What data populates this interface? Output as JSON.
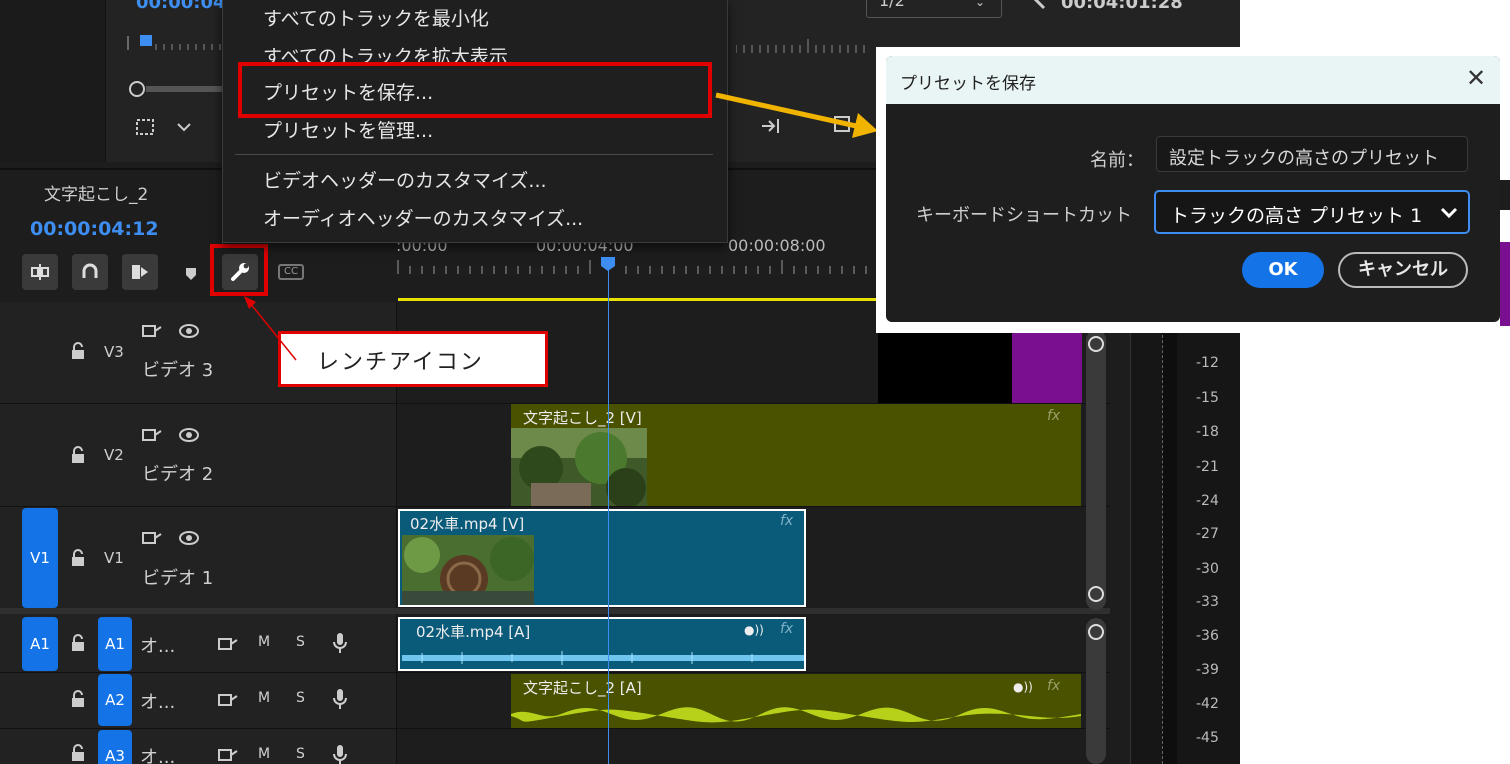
{
  "menu": {
    "items": [
      "すべてのトラックを最小化",
      "すべてのトラックを拡大表示",
      "プリセットを保存...",
      "プリセットを管理...",
      "ビデオヘッダーのカスタマイズ...",
      "オーディオヘッダーのカスタマイズ..."
    ]
  },
  "monitor": {
    "timecode_left": "00:00:04",
    "page_select": "1/2",
    "timecode_right": "00:04:01:28"
  },
  "sequence": {
    "name": "文字起こし_2",
    "timecode": "00:00:04:12"
  },
  "ruler": {
    "labels": [
      ":00:00",
      "00:00:04:00",
      "00:00:08:00"
    ]
  },
  "tracks": {
    "v3": {
      "id": "V3",
      "name": "ビデオ 3"
    },
    "v2": {
      "id": "V2",
      "name": "ビデオ 2"
    },
    "v1": {
      "src": "V1",
      "id": "V1",
      "name": "ビデオ 1"
    },
    "a1": {
      "src": "A1",
      "id": "A1",
      "name": "オ...",
      "m": "M",
      "s": "S"
    },
    "a2": {
      "id": "A2",
      "name": "オ...",
      "m": "M",
      "s": "S"
    },
    "a3": {
      "id": "A3",
      "name": "オ...",
      "m": "M",
      "s": "S"
    }
  },
  "clips": {
    "v2": "文字起こし_2 [V]",
    "v1": "02水車.mp4 [V]",
    "a1": "02水車.mp4 [A]",
    "a2": "文字起こし_2 [A]",
    "fx": "fx"
  },
  "meter": {
    "labels": [
      "-12",
      "-15",
      "-18",
      "-21",
      "-24",
      "-27",
      "-30",
      "-33",
      "-36",
      "-39",
      "-42",
      "-45"
    ]
  },
  "callout": {
    "label": "レンチアイコン"
  },
  "dialog": {
    "title": "プリセットを保存",
    "name_label": "名前：",
    "name_value": "設定トラックの高さのプリセット",
    "shortcut_label": "キーボードショートカット",
    "shortcut_value": "トラックの高さ プリセット 1",
    "ok": "OK",
    "cancel": "キャンセル"
  },
  "colors": {
    "accent_blue": "#1473e6",
    "highlight_red": "#e00000",
    "arrow_yellow": "#f0b400",
    "clip_olive": "#4a5200",
    "clip_teal": "#0a5a7a",
    "clip_purple": "#7a1090",
    "playhead": "#3d8ef0"
  }
}
